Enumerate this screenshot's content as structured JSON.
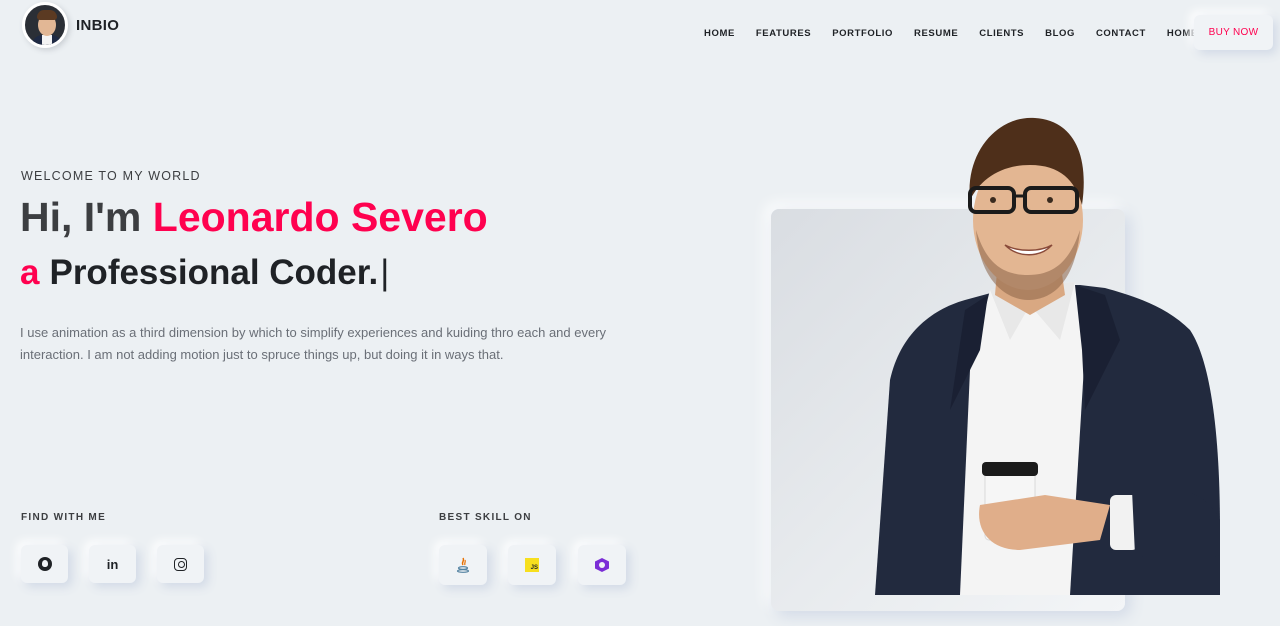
{
  "brand": {
    "name": "INBIO"
  },
  "nav": {
    "items": [
      "HOME",
      "FEATURES",
      "PORTFOLIO",
      "RESUME",
      "CLIENTS",
      "BLOG",
      "CONTACT",
      "HOME"
    ],
    "buy_label": "BUY NOW"
  },
  "hero": {
    "welcome": "WELCOME TO MY WORLD",
    "greeting": "Hi, I'm ",
    "name": "Leonardo Severo",
    "prefix": "a",
    "role": "Professional Coder.",
    "cursor": "|",
    "description": "I use animation as a third dimension by which to simplify experiences and kuiding thro each and every interaction. I am not adding motion just to spruce things up, but doing it in ways that."
  },
  "social": {
    "label": "FIND WITH ME",
    "icons": [
      "github-icon",
      "linkedin-icon",
      "instagram-icon"
    ],
    "linkedin_glyph": "in"
  },
  "skills": {
    "label": "BEST SKILL ON",
    "icons": [
      "java-icon",
      "javascript-icon",
      "csharp-icon"
    ],
    "js_glyph": "JS"
  },
  "colors": {
    "accent": "#ff014f",
    "background": "#ecf0f3",
    "text": "#3c3e41"
  }
}
